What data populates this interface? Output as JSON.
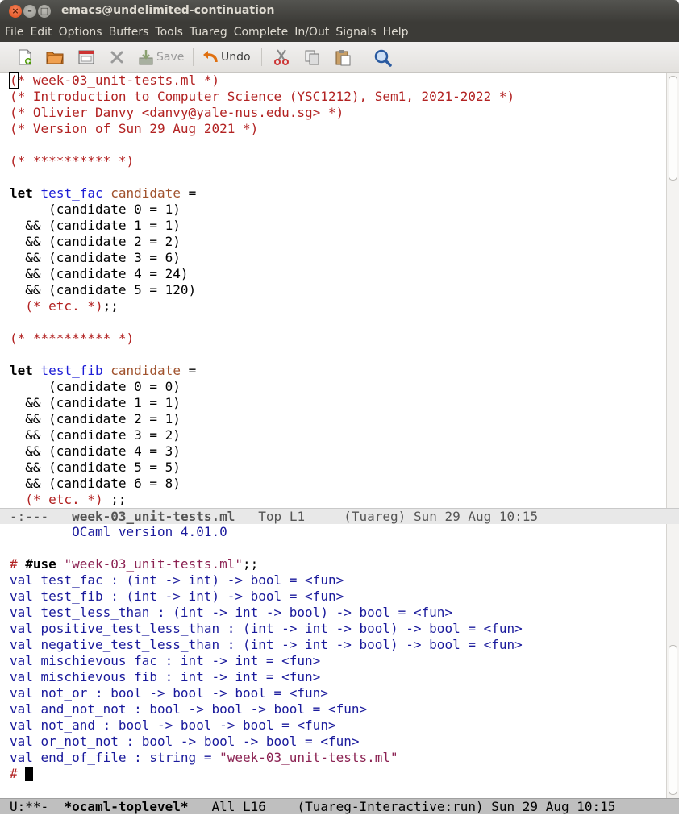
{
  "window": {
    "title": "emacs@undelimited-continuation",
    "close_glyph": "×",
    "min_glyph": "–",
    "max_glyph": "□"
  },
  "menubar": {
    "items": [
      "File",
      "Edit",
      "Options",
      "Buffers",
      "Tools",
      "Tuareg",
      "Complete",
      "In/Out",
      "Signals",
      "Help"
    ]
  },
  "toolbar": {
    "save_label": "Save",
    "undo_label": "Undo",
    "icons": [
      "new-file-icon",
      "open-folder-icon",
      "dired-icon",
      "close-buffer-icon",
      "save-icon",
      "undo-icon",
      "cut-icon",
      "copy-icon",
      "paste-icon",
      "search-icon"
    ]
  },
  "editor": {
    "lines": [
      {
        "parts": [
          [
            "c",
            "(* week-03_unit-tests.ml *)"
          ]
        ]
      },
      {
        "parts": [
          [
            "c",
            "(* Introduction to Computer Science (YSC1212), Sem1, 2021-2022 *)"
          ]
        ]
      },
      {
        "parts": [
          [
            "c",
            "(* Olivier Danvy <danvy@yale-nus.edu.sg> *)"
          ]
        ]
      },
      {
        "parts": [
          [
            "c",
            "(* Version of Sun 29 Aug 2021 *)"
          ]
        ]
      },
      {
        "parts": []
      },
      {
        "parts": [
          [
            "c",
            "(* ********** *)"
          ]
        ]
      },
      {
        "parts": []
      },
      {
        "parts": [
          [
            "k",
            "let"
          ],
          [
            "",
            " "
          ],
          [
            "fn",
            "test_fac"
          ],
          [
            "",
            " "
          ],
          [
            "v",
            "candidate"
          ],
          [
            "",
            " ="
          ]
        ]
      },
      {
        "parts": [
          [
            "",
            "     (candidate 0 = 1)"
          ]
        ]
      },
      {
        "parts": [
          [
            "",
            "  && (candidate 1 = 1)"
          ]
        ]
      },
      {
        "parts": [
          [
            "",
            "  && (candidate 2 = 2)"
          ]
        ]
      },
      {
        "parts": [
          [
            "",
            "  && (candidate 3 = 6)"
          ]
        ]
      },
      {
        "parts": [
          [
            "",
            "  && (candidate 4 = 24)"
          ]
        ]
      },
      {
        "parts": [
          [
            "",
            "  && (candidate 5 = 120)"
          ]
        ]
      },
      {
        "parts": [
          [
            "",
            "  "
          ],
          [
            "c",
            "(* etc. *)"
          ],
          [
            "",
            ";;"
          ]
        ]
      },
      {
        "parts": []
      },
      {
        "parts": [
          [
            "c",
            "(* ********** *)"
          ]
        ]
      },
      {
        "parts": []
      },
      {
        "parts": [
          [
            "k",
            "let"
          ],
          [
            "",
            " "
          ],
          [
            "fn",
            "test_fib"
          ],
          [
            "",
            " "
          ],
          [
            "v",
            "candidate"
          ],
          [
            "",
            " ="
          ]
        ]
      },
      {
        "parts": [
          [
            "",
            "     (candidate 0 = 0)"
          ]
        ]
      },
      {
        "parts": [
          [
            "",
            "  && (candidate 1 = 1)"
          ]
        ]
      },
      {
        "parts": [
          [
            "",
            "  && (candidate 2 = 1)"
          ]
        ]
      },
      {
        "parts": [
          [
            "",
            "  && (candidate 3 = 2)"
          ]
        ]
      },
      {
        "parts": [
          [
            "",
            "  && (candidate 4 = 3)"
          ]
        ]
      },
      {
        "parts": [
          [
            "",
            "  && (candidate 5 = 5)"
          ]
        ]
      },
      {
        "parts": [
          [
            "",
            "  && (candidate 6 = 8)"
          ]
        ]
      },
      {
        "parts": [
          [
            "",
            "  "
          ],
          [
            "c",
            "(* etc. *)"
          ],
          [
            "",
            " ;;"
          ]
        ]
      }
    ],
    "colors": {
      "comment": "#b22222",
      "keyword": "#000000",
      "function": "#1c1cd6",
      "variable": "#a0522d",
      "string": "#8b2252"
    }
  },
  "modeline1": {
    "status": "-:---",
    "buffer": "week-03_unit-tests.ml",
    "position": "Top L1",
    "mode": "(Tuareg) Sun 29 Aug 10:15"
  },
  "toplevel": {
    "lines": [
      {
        "parts": [
          [
            "blue",
            "        OCaml version 4.01.0"
          ]
        ]
      },
      {
        "parts": []
      },
      {
        "parts": [
          [
            "c",
            "# "
          ],
          [
            "k",
            "#use"
          ],
          [
            "",
            " "
          ],
          [
            "s",
            "\"week-03_unit-tests.ml\""
          ],
          [
            "",
            ";;"
          ]
        ]
      },
      {
        "parts": [
          [
            "blue",
            "val test_fac : (int -> int) -> bool = <fun>"
          ]
        ]
      },
      {
        "parts": [
          [
            "blue",
            "val test_fib : (int -> int) -> bool = <fun>"
          ]
        ]
      },
      {
        "parts": [
          [
            "blue",
            "val test_less_than : (int -> int -> bool) -> bool = <fun>"
          ]
        ]
      },
      {
        "parts": [
          [
            "blue",
            "val positive_test_less_than : (int -> int -> bool) -> bool = <fun>"
          ]
        ]
      },
      {
        "parts": [
          [
            "blue",
            "val negative_test_less_than : (int -> int -> bool) -> bool = <fun>"
          ]
        ]
      },
      {
        "parts": [
          [
            "blue",
            "val mischievous_fac : int -> int = <fun>"
          ]
        ]
      },
      {
        "parts": [
          [
            "blue",
            "val mischievous_fib : int -> int = <fun>"
          ]
        ]
      },
      {
        "parts": [
          [
            "blue",
            "val not_or : bool -> bool -> bool = <fun>"
          ]
        ]
      },
      {
        "parts": [
          [
            "blue",
            "val and_not_not : bool -> bool -> bool = <fun>"
          ]
        ]
      },
      {
        "parts": [
          [
            "blue",
            "val not_and : bool -> bool -> bool = <fun>"
          ]
        ]
      },
      {
        "parts": [
          [
            "blue",
            "val or_not_not : bool -> bool -> bool = <fun>"
          ]
        ]
      },
      {
        "parts": [
          [
            "blue",
            "val end_of_file : string = "
          ],
          [
            "s",
            "\"week-03_unit-tests.ml\""
          ]
        ]
      },
      {
        "parts": [
          [
            "c",
            "# "
          ],
          [
            "cursor",
            ""
          ]
        ]
      }
    ]
  },
  "modeline2": {
    "status": "U:**-",
    "buffer": "*ocaml-toplevel*",
    "position": "All L16",
    "mode": "(Tuareg-Interactive:run) Sun 29 Aug 10:15"
  }
}
